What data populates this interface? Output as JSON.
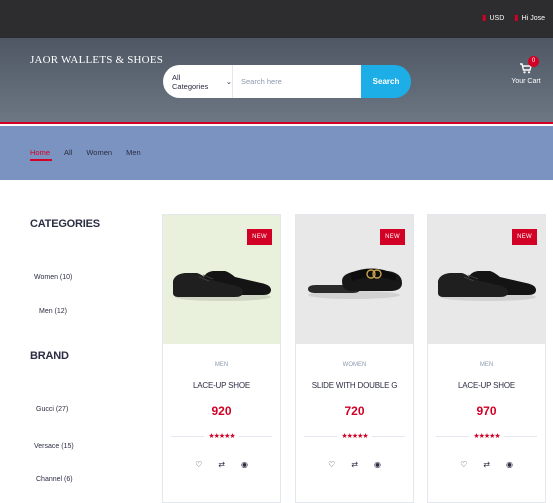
{
  "topbar": {
    "currency": "USD",
    "greeting": "Hi Jose"
  },
  "header": {
    "logo": "JAOR WALLETS & SHOES",
    "search": {
      "category": "All Categories",
      "placeholder": "Search here",
      "button": "Search"
    },
    "cart": {
      "count": "0",
      "label": "Your Cart"
    }
  },
  "nav": {
    "items": [
      "Home",
      "All",
      "Women",
      "Men"
    ],
    "active": "Home"
  },
  "sidebar": {
    "categories_title": "CATEGORIES",
    "categories": [
      "Women (10)",
      "Men (12)"
    ],
    "brand_title": "BRAND",
    "brands": [
      "Gucci (27)",
      "Versace (15)",
      "Channel (6)"
    ]
  },
  "products": [
    {
      "badge": "NEW",
      "category": "MEN",
      "name": "LACE-UP SHOE",
      "price": "920",
      "rating": "★★★★★",
      "bg": "#e9f0dc",
      "shoe": "oxford"
    },
    {
      "badge": "NEW",
      "category": "WOMEN",
      "name": "SLIDE WITH DOUBLE G",
      "price": "720",
      "rating": "★★★★★",
      "bg": "#e8e8e8",
      "shoe": "slide"
    },
    {
      "badge": "NEW",
      "category": "MEN",
      "name": "LACE-UP SHOE",
      "price": "970",
      "rating": "★★★★★",
      "bg": "#e8e8e8",
      "shoe": "oxford"
    }
  ],
  "colors": {
    "accent": "#d10024",
    "search_button": "#1daee8",
    "nav_bg": "#7b93c0",
    "topbar_bg": "#2d2c2e"
  },
  "icons": {
    "wishlist": "heart-icon",
    "compare": "compare-icon",
    "quickview": "eye-icon"
  }
}
